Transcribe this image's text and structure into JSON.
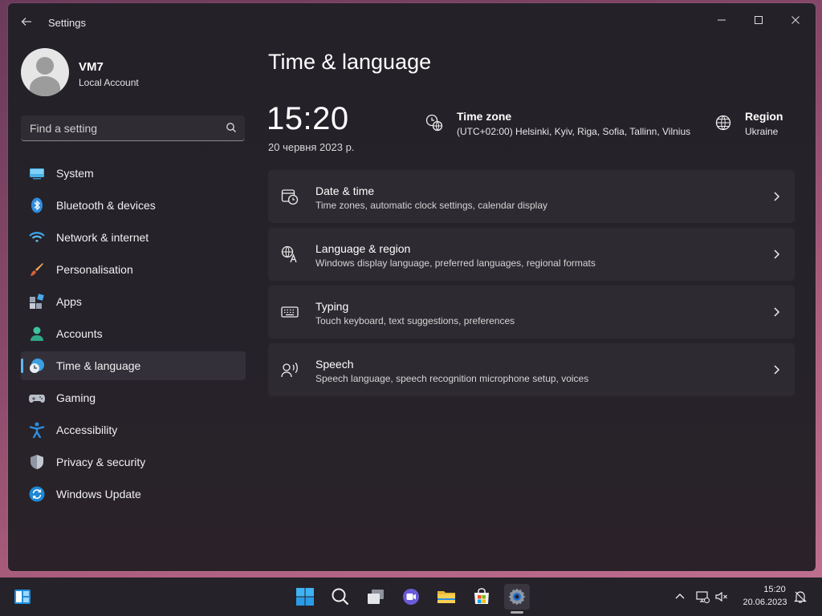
{
  "window": {
    "title": "Settings",
    "back_icon": "back-arrow-icon",
    "controls": [
      "minimize-icon",
      "maximize-icon",
      "close-icon"
    ]
  },
  "profile": {
    "name": "VM7",
    "account_type": "Local Account"
  },
  "search": {
    "placeholder": "Find a setting"
  },
  "sidebar": {
    "items": [
      {
        "label": "System",
        "icon": "system-icon",
        "active": false
      },
      {
        "label": "Bluetooth & devices",
        "icon": "bluetooth-icon",
        "active": false
      },
      {
        "label": "Network & internet",
        "icon": "wifi-icon",
        "active": false
      },
      {
        "label": "Personalisation",
        "icon": "brush-icon",
        "active": false
      },
      {
        "label": "Apps",
        "icon": "apps-icon",
        "active": false
      },
      {
        "label": "Accounts",
        "icon": "accounts-icon",
        "active": false
      },
      {
        "label": "Time & language",
        "icon": "time-language-icon",
        "active": true
      },
      {
        "label": "Gaming",
        "icon": "gamepad-icon",
        "active": false
      },
      {
        "label": "Accessibility",
        "icon": "accessibility-icon",
        "active": false
      },
      {
        "label": "Privacy & security",
        "icon": "shield-icon",
        "active": false
      },
      {
        "label": "Windows Update",
        "icon": "update-icon",
        "active": false
      }
    ]
  },
  "main": {
    "title": "Time & language",
    "clock": "15:20",
    "date": "20 червня 2023 р.",
    "time_zone": {
      "title": "Time zone",
      "value": "(UTC+02:00) Helsinki, Kyiv, Riga, Sofia, Tallinn, Vilnius"
    },
    "region": {
      "title": "Region",
      "value": "Ukraine"
    },
    "cards": [
      {
        "title": "Date & time",
        "subtitle": "Time zones, automatic clock settings, calendar display",
        "icon": "date-time-icon"
      },
      {
        "title": "Language & region",
        "subtitle": "Windows display language, preferred languages, regional formats",
        "icon": "language-icon"
      },
      {
        "title": "Typing",
        "subtitle": "Touch keyboard, text suggestions, preferences",
        "icon": "keyboard-icon"
      },
      {
        "title": "Speech",
        "subtitle": "Speech language, speech recognition microphone setup, voices",
        "icon": "speech-icon"
      }
    ]
  },
  "taskbar": {
    "apps": [
      "widgets-icon",
      "start-icon",
      "search-icon",
      "task-view-icon",
      "chat-icon",
      "file-explorer-icon",
      "store-icon",
      "settings-icon"
    ],
    "tray_icons": [
      "chevron-up-icon",
      "network-icon",
      "volume-muted-icon",
      "notification-icon"
    ],
    "time": "15:20",
    "date": "20.06.2023"
  },
  "colors": {
    "accent": "#60b8f0",
    "window_bg": "#242128",
    "card_bg": "#2d2a31"
  }
}
